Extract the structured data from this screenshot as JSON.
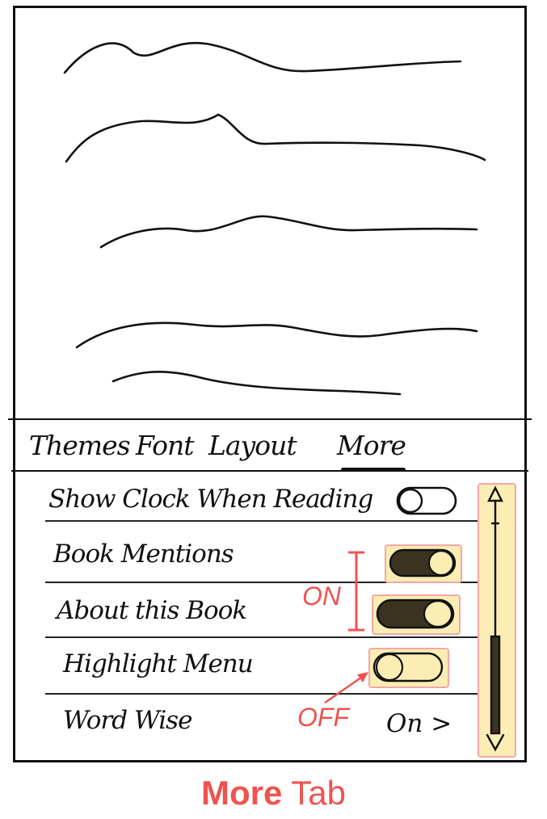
{
  "tabs": [
    {
      "label": "Themes"
    },
    {
      "label": "Font"
    },
    {
      "label": "Layout"
    },
    {
      "label": "More"
    }
  ],
  "settings": [
    {
      "label": "Show Clock When Reading",
      "state": "off"
    },
    {
      "label": "Book Mentions",
      "state": "on"
    },
    {
      "label": "About this Book",
      "state": "on"
    },
    {
      "label": "Highlight Menu",
      "state": "off"
    },
    {
      "label": "Word Wise",
      "value": "On >"
    }
  ],
  "annotations": {
    "on_label": "ON",
    "off_label": "OFF"
  },
  "caption": {
    "bold": "More",
    "rest": " Tab"
  },
  "colors": {
    "highlight_fill": "#fbedb3",
    "highlight_border": "#f4a7a7",
    "annotation": "#ef5350"
  }
}
